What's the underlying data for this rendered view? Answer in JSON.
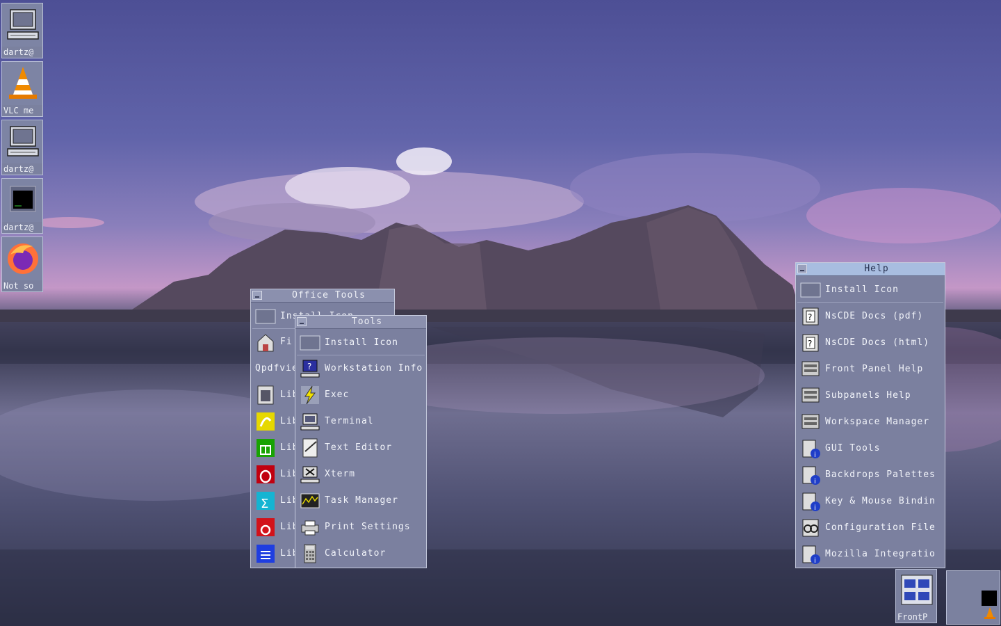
{
  "desktop_icons": [
    {
      "label": "dartz@",
      "icon": "computer-icon"
    },
    {
      "label": "VLC me",
      "icon": "vlc-cone-icon"
    },
    {
      "label": "dartz@",
      "icon": "computer-icon"
    },
    {
      "label": "dartz@",
      "icon": "terminal-window-icon"
    },
    {
      "label": "Not so",
      "icon": "firefox-icon"
    }
  ],
  "office_tools": {
    "title": "Office Tools",
    "items": [
      {
        "label": "Install Icon",
        "icon": "install-icon"
      },
      {
        "label": "Fi",
        "icon": "file-manager-icon"
      },
      {
        "label": "Qpdfvie",
        "icon": ""
      },
      {
        "label": "Lib",
        "icon": "libreoffice-base-icon"
      },
      {
        "label": "Lib",
        "icon": "libreoffice-draw-icon"
      },
      {
        "label": "Lib",
        "icon": "libreoffice-calc-icon"
      },
      {
        "label": "Lib",
        "icon": "libreoffice-impress-icon"
      },
      {
        "label": "Lib",
        "icon": "libreoffice-math-icon"
      },
      {
        "label": "Lib",
        "icon": "libreoffice-icon"
      },
      {
        "label": "Lib",
        "icon": "libreoffice-writer-icon"
      }
    ]
  },
  "tools": {
    "title": "Tools",
    "items": [
      {
        "label": "Install Icon",
        "icon": "install-icon"
      },
      {
        "label": "Workstation Info",
        "icon": "info-monitor-icon"
      },
      {
        "label": "Exec",
        "icon": "lightning-icon"
      },
      {
        "label": "Terminal",
        "icon": "terminal-icon"
      },
      {
        "label": "Text Editor",
        "icon": "text-editor-icon"
      },
      {
        "label": "Xterm",
        "icon": "xterm-icon"
      },
      {
        "label": "Task Manager",
        "icon": "task-manager-icon"
      },
      {
        "label": "Print Settings",
        "icon": "printer-icon"
      },
      {
        "label": "Calculator",
        "icon": "calculator-icon"
      }
    ]
  },
  "help": {
    "title": "Help",
    "items": [
      {
        "label": "Install Icon",
        "icon": "install-icon"
      },
      {
        "label": "NsCDE Docs (pdf)",
        "icon": "help-book-icon"
      },
      {
        "label": "NsCDE Docs (html)",
        "icon": "help-book-icon"
      },
      {
        "label": "Front Panel Help",
        "icon": "help-panel-icon"
      },
      {
        "label": "Subpanels Help",
        "icon": "help-panel-icon"
      },
      {
        "label": "Workspace Manager",
        "icon": "help-panel-icon"
      },
      {
        "label": "GUI Tools",
        "icon": "info-doc-icon"
      },
      {
        "label": "Backdrops Palettes",
        "icon": "info-doc-icon"
      },
      {
        "label": "Key & Mouse Bindin",
        "icon": "info-doc-icon"
      },
      {
        "label": "Configuration File",
        "icon": "config-icon"
      },
      {
        "label": "Mozilla Integratio",
        "icon": "info-doc-icon"
      }
    ]
  },
  "front_panel": {
    "label": "FrontP",
    "icon": "front-panel-icon"
  },
  "pager": {
    "icon": "pager-icon"
  }
}
